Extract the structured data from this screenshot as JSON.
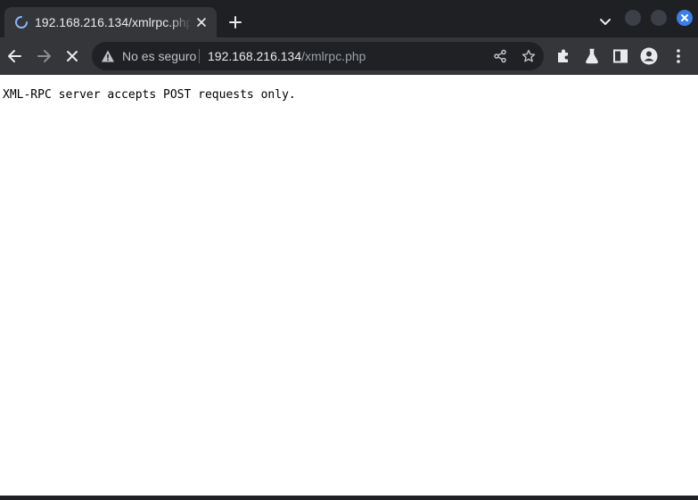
{
  "tab": {
    "title": "192.168.216.134/xmlrpc.php",
    "loading": true
  },
  "omnibox": {
    "security_text": "No es seguro",
    "url_host": "192.168.216.134",
    "url_path": "/xmlrpc.php"
  },
  "page": {
    "text": "XML-RPC server accepts POST requests only."
  },
  "icons": {
    "tab_spinner": "loading-spinner-icon",
    "tab_close": "close-icon",
    "new_tab": "plus-icon",
    "tab_search": "chevron-down-icon",
    "back": "arrow-left-icon",
    "forward": "arrow-right-icon",
    "stop": "close-icon",
    "not_secure": "warning-triangle-icon",
    "share": "share-icon",
    "bookmark": "star-icon",
    "extensions": "puzzle-icon",
    "labs": "flask-icon",
    "side_panel": "side-panel-icon",
    "profile": "profile-icon",
    "menu": "kebab-menu-icon"
  },
  "colors": {
    "frame": "#1f2023",
    "toolbar": "#35363a",
    "omnibox": "#202124",
    "accent": "#3a7ee8",
    "page_bg": "#ffffff"
  }
}
